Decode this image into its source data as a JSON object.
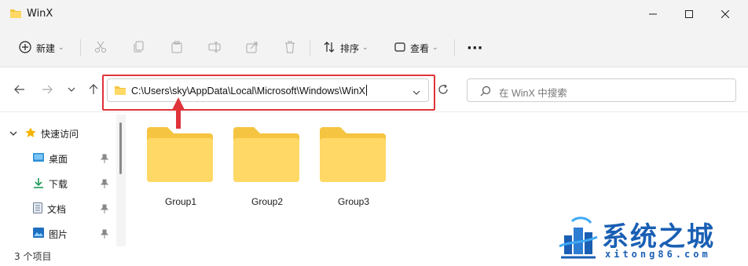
{
  "window": {
    "title": "WinX"
  },
  "toolbar": {
    "new_label": "新建",
    "sort_label": "排序",
    "view_label": "查看",
    "more_label": "···"
  },
  "navigation": {
    "address": "C:\\Users\\sky\\AppData\\Local\\Microsoft\\Windows\\WinX",
    "search_placeholder": "在 WinX 中搜索"
  },
  "sidebar": {
    "items": [
      {
        "label": "快速访问",
        "icon": "star-icon"
      },
      {
        "label": "桌面",
        "icon": "desktop-icon"
      },
      {
        "label": "下载",
        "icon": "download-icon"
      },
      {
        "label": "文档",
        "icon": "document-icon"
      },
      {
        "label": "图片",
        "icon": "pictures-icon"
      }
    ]
  },
  "content": {
    "folders": [
      {
        "name": "Group1"
      },
      {
        "name": "Group2"
      },
      {
        "name": "Group3"
      }
    ]
  },
  "status": {
    "item_count": "3 个项目"
  },
  "watermark": {
    "title": "系统之城",
    "url": "xitong86.com"
  },
  "colors": {
    "folder": "#ffd866",
    "highlight": "#e0333a",
    "watermark": "#1a5fb4"
  }
}
